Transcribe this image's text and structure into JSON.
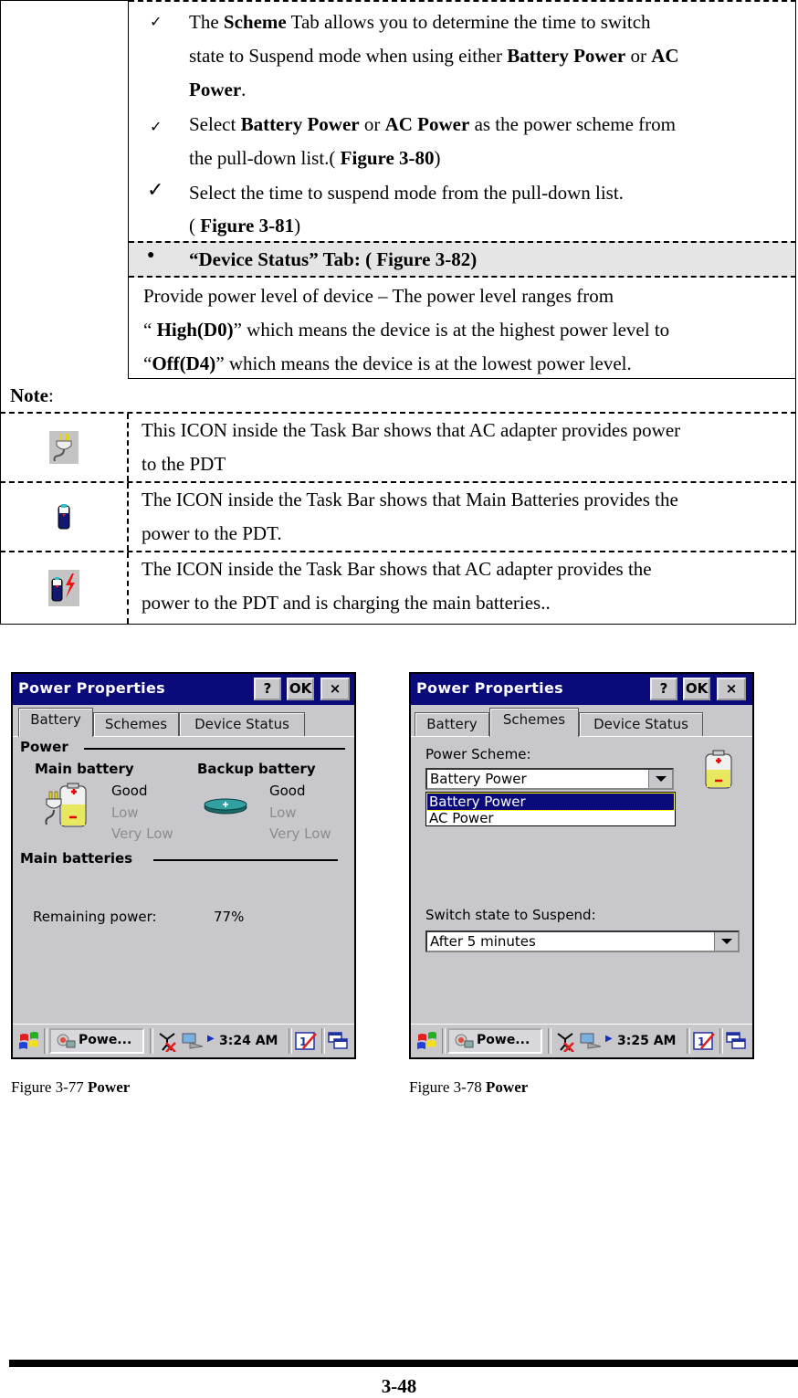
{
  "instructions": {
    "bullet1": {
      "pre": "The ",
      "bold1": "Scheme",
      "mid1": " Tab allows you to determine the time to switch",
      "line2_pre": "state to Suspend mode when using either ",
      "bold2": "Battery Power",
      "mid2": " or ",
      "bold3": "AC",
      "line3_bold": "Power",
      "line3_post": "."
    },
    "bullet2": {
      "pre": "Select ",
      "bold1": "Battery Power",
      "mid1": " or ",
      "bold2": "AC Power",
      "post1": " as the power scheme from",
      "line2_pre": "the pull-down list.( ",
      "line2_bold": "Figure 3-80",
      "line2_post": ")"
    },
    "bullet3": {
      "text": "Select the time to suspend mode from the pull-down list.",
      "line2_pre": "( ",
      "line2_bold": "Figure 3-81",
      "line2_post": ")"
    },
    "check_glyph": "✓",
    "bullet_glyph": "●"
  },
  "device_status_header": "“Device Status” Tab: ( Figure 3-82)",
  "device_status_desc": {
    "line1": "Provide power level of device – The power level ranges from",
    "line2_pre": "“ ",
    "line2_bold": "High(D0)",
    "line2_post": "” which means the device is at the highest power level to",
    "line3_pre": "“",
    "line3_bold": "Off(D4)",
    "line3_post": "” which means the device is at the lowest power level."
  },
  "note": {
    "label": "Note",
    "colon": ":",
    "rows": [
      {
        "icon": "ac-adapter-icon",
        "line1": "This ICON inside the Task Bar shows that AC adapter provides power",
        "line2": "to the PDT"
      },
      {
        "icon": "main-battery-icon",
        "line1": "The ICON inside the Task Bar shows that Main Batteries provides the",
        "line2": "power to the PDT."
      },
      {
        "icon": "charging-battery-icon",
        "line1": "The ICON inside the Task Bar shows that AC adapter provides the",
        "line2": "power to the PDT and is charging the main batteries.."
      }
    ]
  },
  "figures": [
    {
      "window_title": "Power Properties",
      "buttons": {
        "help": "?",
        "ok": "OK",
        "close": "×"
      },
      "tabs": [
        "Battery",
        "Schemes",
        "Device Status"
      ],
      "active_tab": "Battery",
      "power_group": "Power",
      "main_battery_label": "Main battery",
      "backup_battery_label": "Backup battery",
      "levels": [
        "Good",
        "Low",
        "Very Low"
      ],
      "main_batteries_group": "Main batteries",
      "remaining_label": "Remaining power:",
      "remaining_value": "77%",
      "taskbar": {
        "task": "Powe...",
        "time": "3:24 AM",
        "input": "1"
      },
      "caption_pre": "Figure 3-77 ",
      "caption_bold": "Power"
    },
    {
      "window_title": "Power Properties",
      "buttons": {
        "help": "?",
        "ok": "OK",
        "close": "×"
      },
      "tabs": [
        "Battery",
        "Schemes",
        "Device Status"
      ],
      "active_tab": "Schemes",
      "power_scheme_label": "Power Scheme:",
      "power_scheme_value": "Battery Power",
      "power_scheme_options": [
        "Battery Power",
        "AC Power"
      ],
      "suspend_label": "Switch state to Suspend:",
      "suspend_value": "After 5 minutes",
      "taskbar": {
        "task": "Powe...",
        "time": "3:25 AM",
        "input": "1"
      },
      "caption_pre": "Figure 3-78 ",
      "caption_bold": "Power"
    }
  ],
  "page_number": "3-48"
}
